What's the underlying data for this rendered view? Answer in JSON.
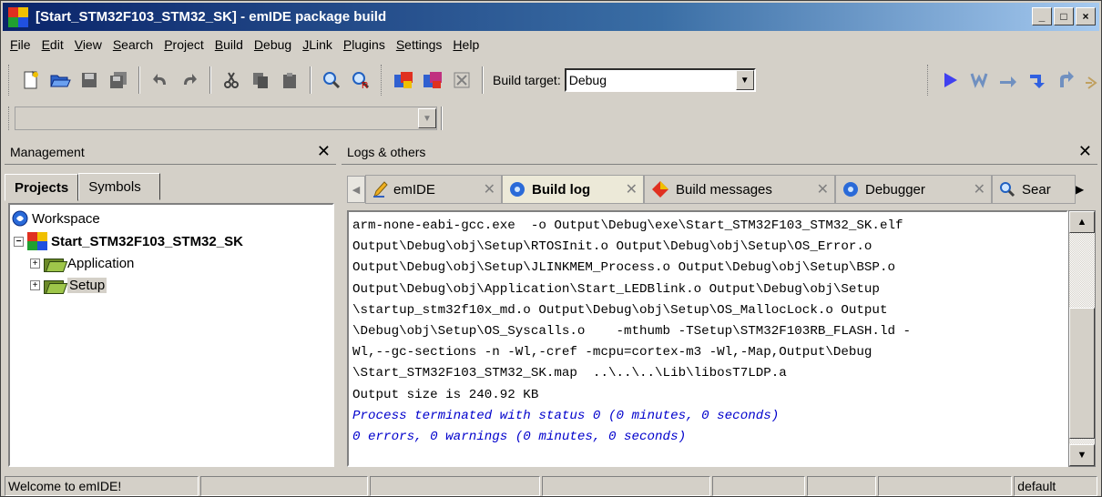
{
  "window": {
    "title": "[Start_STM32F103_STM32_SK] - emIDE package build",
    "controls": [
      "_",
      "□",
      "×"
    ]
  },
  "menu": [
    "File",
    "Edit",
    "View",
    "Search",
    "Project",
    "Build",
    "Debug",
    "JLink",
    "Plugins",
    "Settings",
    "Help"
  ],
  "toolbar": {
    "build_target_label": "Build target:",
    "build_target_value": "Debug"
  },
  "management": {
    "title": "Management",
    "tabs": [
      "Projects",
      "Symbols"
    ],
    "tree": {
      "workspace": "Workspace",
      "project": "Start_STM32F103_STM32_SK",
      "folders": [
        "Application",
        "Setup"
      ]
    }
  },
  "logs": {
    "title": "Logs & others",
    "tabs": [
      {
        "label": "emIDE",
        "active": false
      },
      {
        "label": "Build log",
        "active": true
      },
      {
        "label": "Build messages",
        "active": false
      },
      {
        "label": "Debugger",
        "active": false
      },
      {
        "label": "Sear",
        "active": false
      }
    ],
    "lines": [
      "arm-none-eabi-gcc.exe  -o Output\\Debug\\exe\\Start_STM32F103_STM32_SK.elf",
      "Output\\Debug\\obj\\Setup\\RTOSInit.o Output\\Debug\\obj\\Setup\\OS_Error.o",
      "Output\\Debug\\obj\\Setup\\JLINKMEM_Process.o Output\\Debug\\obj\\Setup\\BSP.o",
      "Output\\Debug\\obj\\Application\\Start_LEDBlink.o Output\\Debug\\obj\\Setup",
      "\\startup_stm32f10x_md.o Output\\Debug\\obj\\Setup\\OS_MallocLock.o Output",
      "\\Debug\\obj\\Setup\\OS_Syscalls.o    -mthumb -TSetup\\STM32F103RB_FLASH.ld -",
      "Wl,--gc-sections -n -Wl,-cref -mcpu=cortex-m3 -Wl,-Map,Output\\Debug",
      "\\Start_STM32F103_STM32_SK.map  ..\\..\\..\\Lib\\libosT7LDP.a",
      "Output size is 240.92 KB"
    ],
    "status_lines": [
      "Process terminated with status 0 (0 minutes, 0 seconds)",
      "0 errors, 0 warnings (0 minutes, 0 seconds)"
    ]
  },
  "statusbar": {
    "message": "Welcome to emIDE!",
    "right": "default"
  },
  "colors": {
    "titlebar_start": "#0a246a",
    "titlebar_end": "#a6caf0",
    "status_text": "#0000cc"
  }
}
